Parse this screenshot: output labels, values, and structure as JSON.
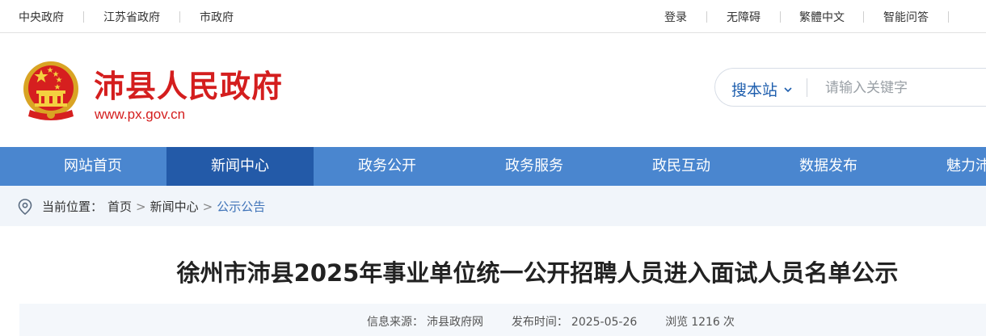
{
  "topbar": {
    "left_links": [
      "中央政府",
      "江苏省政府",
      "市政府"
    ],
    "right_links": [
      "登录",
      "无障碍",
      "繁體中文",
      "智能问答"
    ]
  },
  "header": {
    "site_name": "沛县人民政府",
    "site_url": "www.px.gov.cn",
    "brand_color": "#d41e1e"
  },
  "search": {
    "scope_label": "搜本站",
    "placeholder": "请输入关键字"
  },
  "nav": {
    "items": [
      {
        "label": "网站首页"
      },
      {
        "label": "新闻中心",
        "active": true
      },
      {
        "label": "政务公开"
      },
      {
        "label": "政务服务"
      },
      {
        "label": "政民互动"
      },
      {
        "label": "数据发布"
      },
      {
        "label": "魅力沛县"
      }
    ],
    "bg_color": "#4a86cf",
    "active_color": "#235aa8"
  },
  "breadcrumb": {
    "prefix": "当前位置：",
    "items": [
      "首页",
      "新闻中心",
      "公示公告"
    ],
    "separator": ">"
  },
  "article": {
    "title": "徐州市沛县2025年事业单位统一公开招聘人员进入面试人员名单公示",
    "source_label": "信息来源：",
    "source": "沛县政府网",
    "date_label": "发布时间：",
    "date": "2025-05-26",
    "views_label": "浏览",
    "views": "1216",
    "views_unit": "次"
  }
}
